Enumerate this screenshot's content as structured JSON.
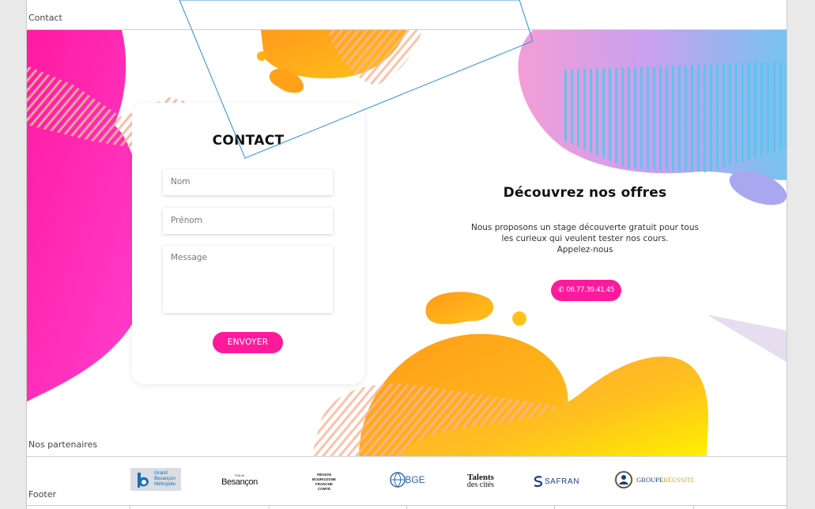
{
  "sections": {
    "contact_label": "Contact",
    "partners_label": "Nos partenaires",
    "footer_label": "Footer"
  },
  "contact_form": {
    "title": "CONTACT",
    "nom_placeholder": "Nom",
    "prenom_placeholder": "Prénom",
    "message_placeholder": "Message",
    "submit_label": "ENVOYER"
  },
  "offers": {
    "title": "Découvrez nos offres",
    "line1": "Nous proposons un stage découverte gratuit pour tous",
    "line2": "les curieux qui veulent tester nos cours.",
    "line3": "Appelez-nous",
    "phone": "06.77.39.41.45",
    "phone_icon": "phone-icon"
  },
  "partners": [
    {
      "name": "Grand Besançon Métropole",
      "l1": "Grand",
      "l2": "Besançon",
      "l3": "Métropole"
    },
    {
      "name": "Ville de Besançon",
      "small": "Ville de",
      "main": "Besançon"
    },
    {
      "name": "Région Bourgogne Franche Comté",
      "l1": "RÉGION",
      "l2": "BOURGOGNE",
      "l3": "FRANCHE",
      "l4": "COMTÉ"
    },
    {
      "name": "BGE",
      "text": "BGE"
    },
    {
      "name": "Talents des cités",
      "l1": "Talents",
      "l2": "des cités"
    },
    {
      "name": "Safran",
      "text": "SAFRAN"
    },
    {
      "name": "Groupe Réussite",
      "a": "GROUPE",
      "b": "RÉUSSITE"
    }
  ],
  "colors": {
    "accent": "#ff1a9c",
    "orange": "#ffa21a",
    "pink": "#ff2db4",
    "blue": "#6fc6ee"
  }
}
